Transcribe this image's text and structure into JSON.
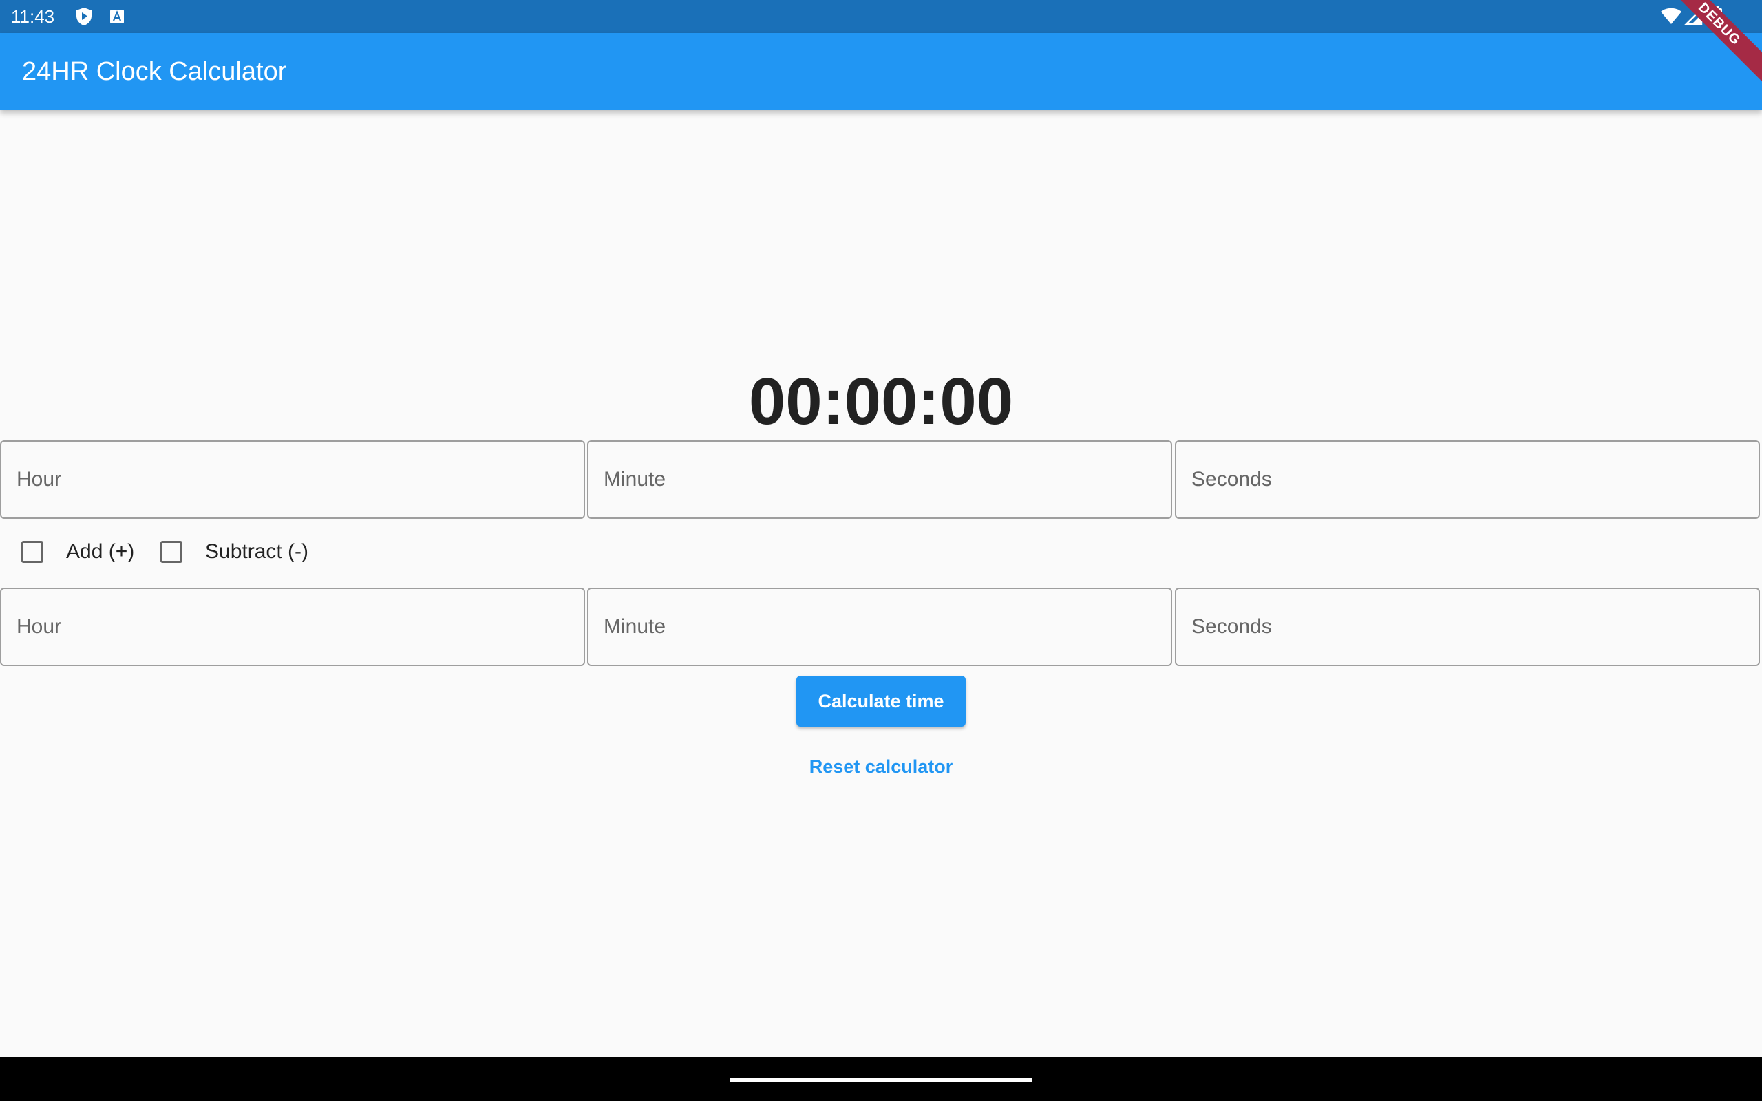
{
  "status_bar": {
    "time": "11:43",
    "icons": [
      "shield-play-icon",
      "app-a-icon",
      "wifi-icon",
      "signal-icon",
      "battery-icon"
    ]
  },
  "app_bar": {
    "title": "24HR Clock Calculator",
    "debug_banner": "DEBUG",
    "color": "#2196f3"
  },
  "calculator": {
    "result": "00:00:00",
    "first_row": {
      "hour_placeholder": "Hour",
      "minute_placeholder": "Minute",
      "seconds_placeholder": "Seconds"
    },
    "operations": {
      "add_label": "Add (+)",
      "add_checked": false,
      "subtract_label": "Subtract (-)",
      "subtract_checked": false
    },
    "second_row": {
      "hour_placeholder": "Hour",
      "minute_placeholder": "Minute",
      "seconds_placeholder": "Seconds"
    },
    "calculate_label": "Calculate time",
    "reset_label": "Reset calculator"
  },
  "colors": {
    "status_bar": "#1a70b8",
    "primary": "#2196f3",
    "background": "#fafafa"
  }
}
